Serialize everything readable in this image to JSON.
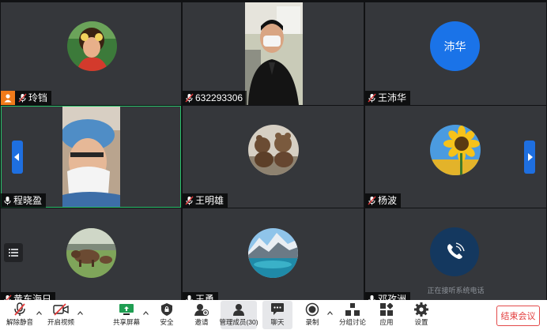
{
  "participants": [
    {
      "name": "玲铛",
      "host": true,
      "muted": true,
      "video_off": true
    },
    {
      "name": "632293306",
      "host": false,
      "muted": true,
      "video_off": false
    },
    {
      "name": "王沛华",
      "host": false,
      "muted": true,
      "video_off": true,
      "avatar_text": "沛华",
      "avatar_color": "#1a73e8"
    },
    {
      "name": "程晓盈",
      "host": false,
      "muted": false,
      "video_off": false,
      "active_speaker": true
    },
    {
      "name": "王明雄",
      "host": false,
      "muted": true,
      "video_off": true
    },
    {
      "name": "杨波",
      "host": false,
      "muted": true,
      "video_off": true
    },
    {
      "name": "黄东海日",
      "host": false,
      "muted": true,
      "video_off": true
    },
    {
      "name": "王勇",
      "host": false,
      "muted": false,
      "video_off": true
    },
    {
      "name": "邓孜洲",
      "host": false,
      "muted": false,
      "video_off": true,
      "status": "正在接听系统电话"
    }
  ],
  "toolbar": {
    "unmute": "解除静音",
    "start_video": "开启视频",
    "share_screen": "共享屏幕",
    "security": "安全",
    "invite": "邀请",
    "manage_members": "管理成员(30)",
    "chat": "聊天",
    "record": "录制",
    "breakout": "分组讨论",
    "apps": "应用",
    "settings": "设置",
    "end_meeting": "结束会议"
  },
  "colors": {
    "accent": "#1e6fe0",
    "host_badge": "#f07a1a",
    "active_border": "#29c16b",
    "end_red": "#e33b3b",
    "tile_bg": "#35373b"
  },
  "icons": [
    "mic-muted-icon",
    "mic-icon",
    "host-icon",
    "video-off-icon",
    "share-screen-icon",
    "shield-icon",
    "invite-icon",
    "members-icon",
    "chat-icon",
    "record-icon",
    "breakout-icon",
    "apps-icon",
    "gear-icon",
    "phone-icon",
    "list-icon",
    "chevron-left-icon",
    "chevron-right-icon",
    "caret-up-icon"
  ]
}
